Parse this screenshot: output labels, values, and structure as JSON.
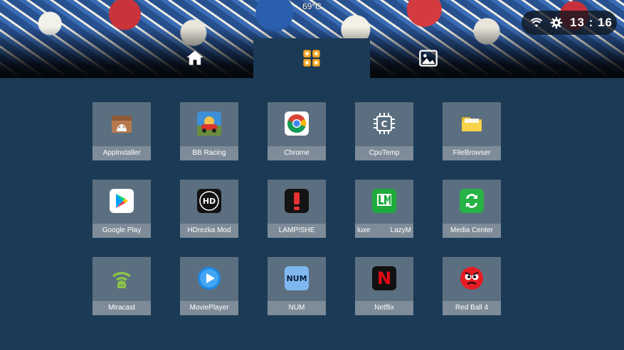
{
  "status_bar": {
    "temperature": "69°C",
    "time": "13 : 16",
    "wifi_icon": "wifi-icon",
    "settings_icon": "gear-icon"
  },
  "tabs": [
    {
      "icon": "home-icon",
      "active": false
    },
    {
      "icon": "apps-grid-icon",
      "active": true
    },
    {
      "icon": "gallery-icon",
      "active": false
    }
  ],
  "apps": [
    {
      "label": "AppInstaller",
      "icon": "app-installer-icon"
    },
    {
      "label": "BB Racing",
      "icon": "bb-racing-icon"
    },
    {
      "label": "Chrome",
      "icon": "chrome-icon"
    },
    {
      "label": "CpuTemp",
      "icon": "cpu-temp-icon"
    },
    {
      "label": "FileBrowser",
      "icon": "folder-icon"
    },
    {
      "label": "Google Play",
      "icon": "google-play-icon"
    },
    {
      "label": "HDrezka Mod",
      "icon": "hdrezka-icon"
    },
    {
      "label": "LAMP!SHE",
      "icon": "lampshe-icon"
    },
    {
      "label_left": "luxe",
      "label_right": "LazyM",
      "icon": "lazymedia-icon"
    },
    {
      "label": "Media Center",
      "icon": "media-center-icon"
    },
    {
      "label": "Miracast",
      "icon": "miracast-icon"
    },
    {
      "label": "MoviePlayer",
      "icon": "movie-player-icon"
    },
    {
      "label": "NUM",
      "icon": "num-icon",
      "icon_text": "NUM"
    },
    {
      "label": "Netflix",
      "icon": "netflix-icon",
      "icon_text": "N"
    },
    {
      "label": "Red Ball 4",
      "icon": "red-ball-icon"
    }
  ],
  "colors": {
    "background": "#1b3a55",
    "tile": "#5b6f80",
    "tile_label": "#7e8c99",
    "active_tab_icon": "#f5a623"
  }
}
